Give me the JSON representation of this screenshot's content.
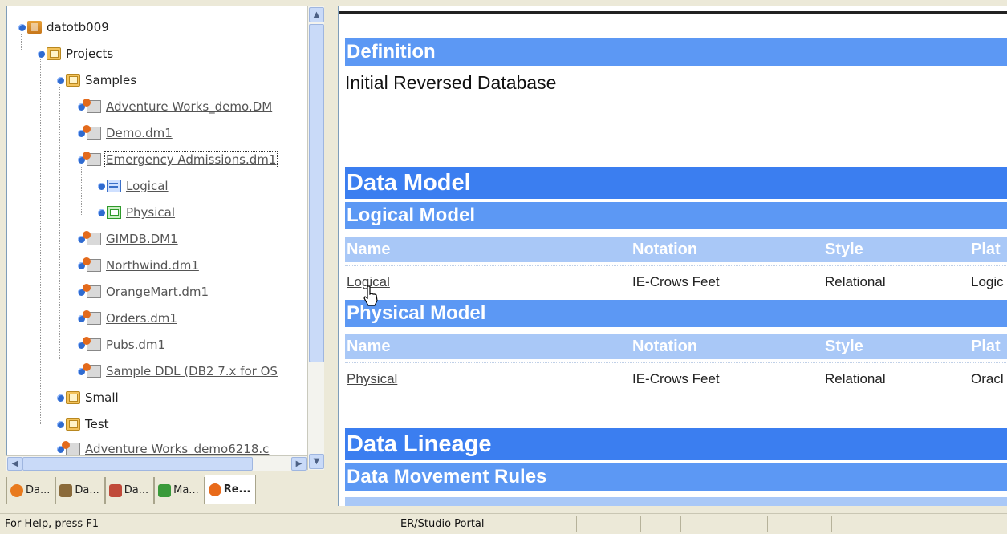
{
  "tree": {
    "items": [
      {
        "label": "datotb009",
        "icon": "database-icon"
      },
      {
        "label": "Projects",
        "icon": "project-folder-icon"
      },
      {
        "label": "Samples",
        "icon": "project-folder-icon"
      },
      {
        "label": "Adventure Works_demo.DM",
        "icon": "model-icon"
      },
      {
        "label": "Demo.dm1",
        "icon": "model-icon"
      },
      {
        "label": "Emergency Admissions.dm1",
        "icon": "model-icon"
      },
      {
        "label": "Logical",
        "icon": "logical-model-icon"
      },
      {
        "label": "Physical",
        "icon": "physical-model-icon"
      },
      {
        "label": "GIMDB.DM1",
        "icon": "model-icon"
      },
      {
        "label": "Northwind.dm1",
        "icon": "model-icon"
      },
      {
        "label": "OrangeMart.dm1",
        "icon": "model-icon"
      },
      {
        "label": "Orders.dm1",
        "icon": "model-icon"
      },
      {
        "label": "Pubs.dm1",
        "icon": "model-icon"
      },
      {
        "label": "Sample DDL (DB2 7.x for OS",
        "icon": "model-icon"
      },
      {
        "label": "Small",
        "icon": "project-folder-icon"
      },
      {
        "label": "Test",
        "icon": "project-folder-icon"
      },
      {
        "label": "Adventure Works_demo6218.c",
        "icon": "model-icon"
      }
    ],
    "selected_index": 5
  },
  "tabs": [
    {
      "label": "Da...",
      "icon": "data-source-icon",
      "color": "#e87a1e"
    },
    {
      "label": "Da...",
      "icon": "data-dictionary-icon",
      "color": "#8a6a3a"
    },
    {
      "label": "Da...",
      "icon": "data-lineage-icon",
      "color": "#c04a3a"
    },
    {
      "label": "Ma...",
      "icon": "macro-icon",
      "color": "#3a9a3a"
    },
    {
      "label": "Re...",
      "icon": "repository-icon",
      "color": "#e86a1a"
    }
  ],
  "active_tab": 4,
  "content": {
    "definition_heading": "Definition",
    "definition_text": "Initial Reversed Database",
    "data_model_heading": "Data Model",
    "logical_model_heading": "Logical Model",
    "physical_model_heading": "Physical Model",
    "columns": [
      "Name",
      "Notation",
      "Style",
      "Plat"
    ],
    "logical_row": [
      "Logical",
      "IE-Crows Feet",
      "Relational",
      "Logic"
    ],
    "physical_row": [
      "Physical",
      "IE-Crows Feet",
      "Relational",
      "Oracl"
    ],
    "data_lineage_heading": "Data Lineage",
    "data_movement_heading": "Data Movement Rules"
  },
  "status": {
    "help": "For Help, press F1",
    "app": "ER/Studio Portal"
  }
}
